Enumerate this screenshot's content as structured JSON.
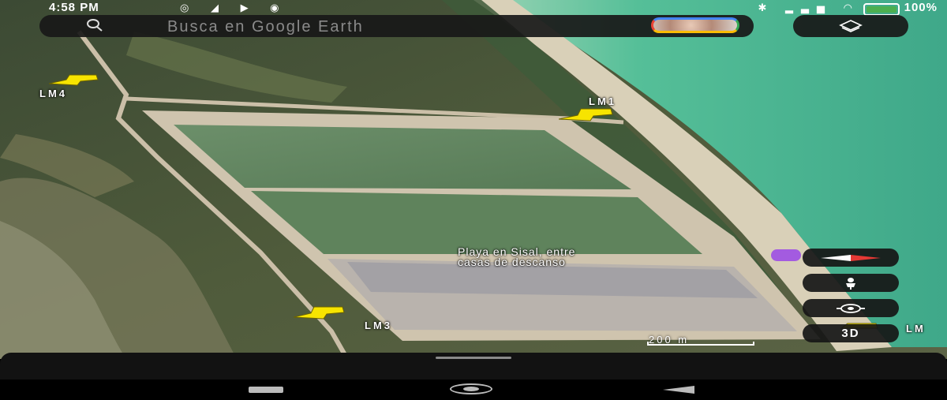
{
  "status_bar": {
    "time": "4:58 PM",
    "left_icons": "◎ ◢ ▶ ◉",
    "right_icons": "✱ ▂▃▅ ◠",
    "battery_percent": "100%",
    "battery_color": "#4caf50"
  },
  "search": {
    "placeholder": "Busca en Google Earth",
    "icon": "search-icon"
  },
  "layers_button": {
    "icon": "layers-icon"
  },
  "pins": [
    {
      "label": "LM4"
    },
    {
      "label": "LM1"
    },
    {
      "label": "LM3"
    },
    {
      "label": "LM"
    }
  ],
  "place": {
    "label_line1": "Playa en Sisal, entre",
    "label_line2": "casas de descanso"
  },
  "controls": {
    "compass": "compass-icon",
    "street_view": "pegman-icon",
    "location": "my-location-icon",
    "view_mode": "3D"
  },
  "scale": {
    "label": "200 m"
  },
  "colors": {
    "pin": "#f7e400",
    "sea": "#4cb896",
    "accent": "#4285f4"
  }
}
